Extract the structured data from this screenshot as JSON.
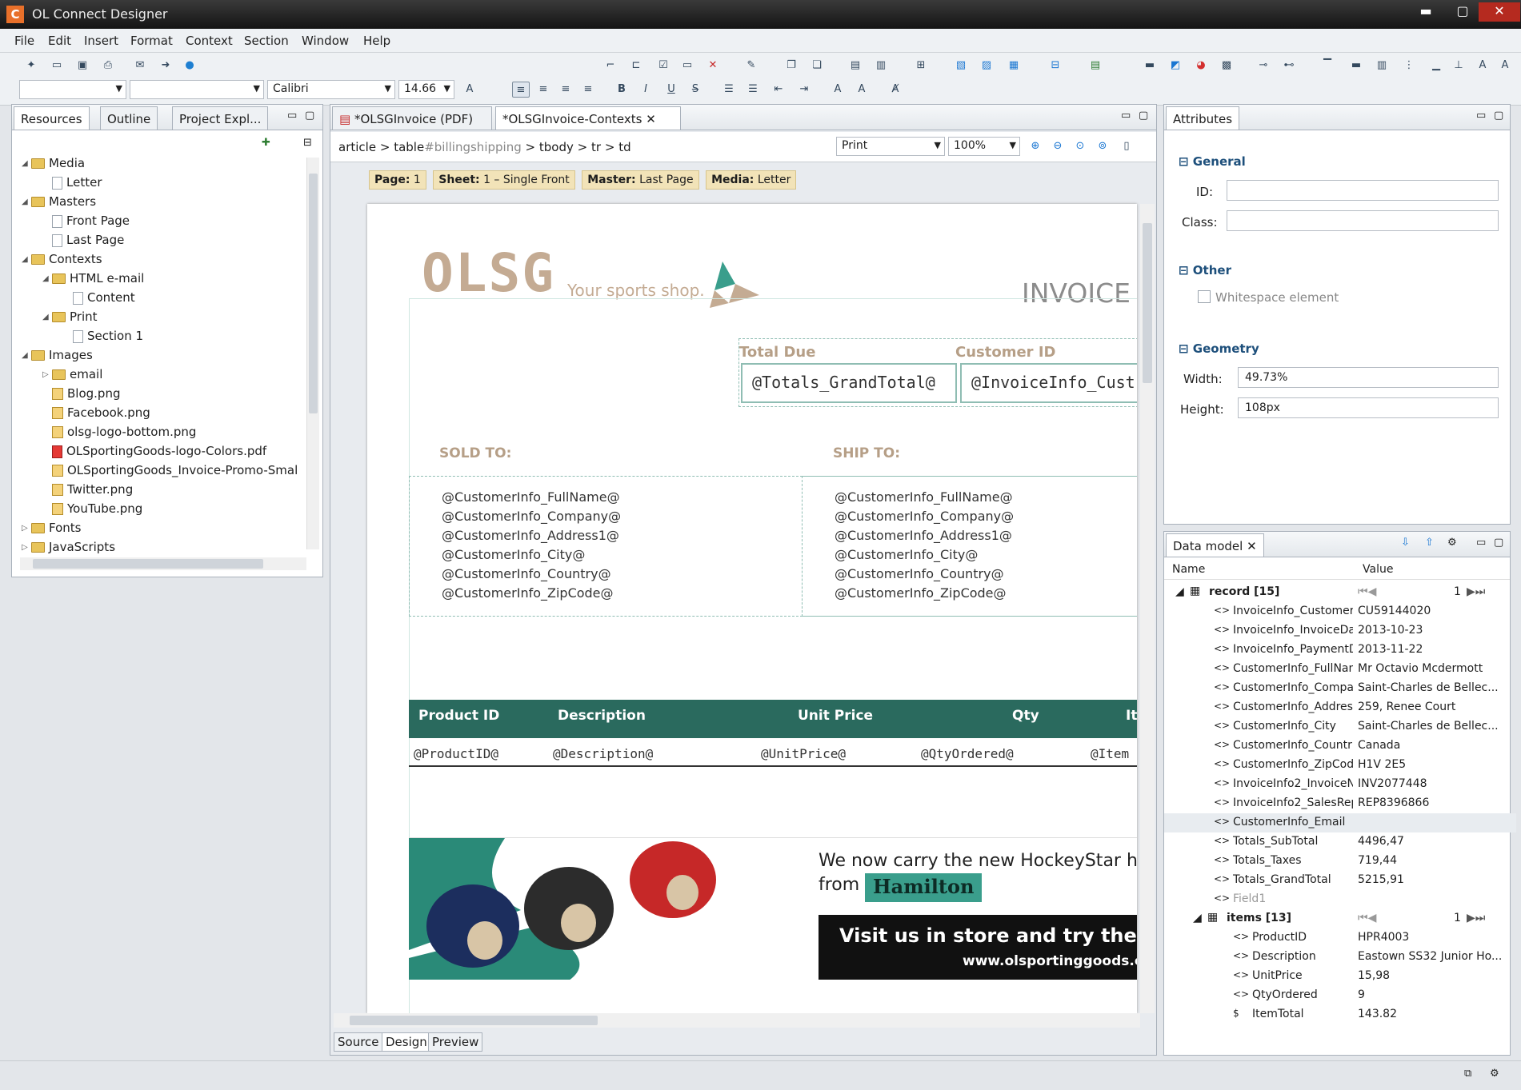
{
  "window": {
    "title": "OL Connect Designer",
    "minimize": "▬",
    "maximize": "▢",
    "close": "✕"
  },
  "menu": [
    "File",
    "Edit",
    "Insert",
    "Format",
    "Context",
    "Section",
    "Window",
    "Help"
  ],
  "toolbar": {
    "font": "Calibri",
    "size": "14.66"
  },
  "left_panel": {
    "tabs": [
      "Resources",
      "Outline",
      "Project Expl..."
    ],
    "tree": [
      {
        "label": "Media",
        "indent": 0,
        "kind": "folder",
        "open": true
      },
      {
        "label": "Letter",
        "indent": 1,
        "kind": "file"
      },
      {
        "label": "Masters",
        "indent": 0,
        "kind": "folder",
        "open": true
      },
      {
        "label": "Front Page",
        "indent": 1,
        "kind": "file"
      },
      {
        "label": "Last Page",
        "indent": 1,
        "kind": "file"
      },
      {
        "label": "Contexts",
        "indent": 0,
        "kind": "folder",
        "open": true
      },
      {
        "label": "HTML e-mail",
        "indent": 1,
        "kind": "folder",
        "open": true
      },
      {
        "label": "Content",
        "indent": 2,
        "kind": "file"
      },
      {
        "label": "Print",
        "indent": 1,
        "kind": "folder",
        "open": true
      },
      {
        "label": "Section 1",
        "indent": 2,
        "kind": "file"
      },
      {
        "label": "Images",
        "indent": 0,
        "kind": "folder",
        "open": true
      },
      {
        "label": "email",
        "indent": 1,
        "kind": "folder",
        "open": false
      },
      {
        "label": "Blog.png",
        "indent": 1,
        "kind": "img"
      },
      {
        "label": "Facebook.png",
        "indent": 1,
        "kind": "img"
      },
      {
        "label": "olsg-logo-bottom.png",
        "indent": 1,
        "kind": "img"
      },
      {
        "label": "OLSportingGoods-logo-Colors.pdf",
        "indent": 1,
        "kind": "pdf"
      },
      {
        "label": "OLSportingGoods_Invoice-Promo-Smal",
        "indent": 1,
        "kind": "img"
      },
      {
        "label": "Twitter.png",
        "indent": 1,
        "kind": "img"
      },
      {
        "label": "YouTube.png",
        "indent": 1,
        "kind": "img"
      },
      {
        "label": "Fonts",
        "indent": 0,
        "kind": "folder",
        "open": false
      },
      {
        "label": "JavaScripts",
        "indent": 0,
        "kind": "folder",
        "open": false
      }
    ]
  },
  "editor": {
    "tabs": [
      "*OLSGInvoice (PDF)",
      "*OLSGInvoice-Contexts"
    ],
    "breadcrumb": [
      "article",
      ">",
      "table",
      "#billingshipping",
      ">",
      "tbody",
      ">",
      "tr",
      ">",
      "td"
    ],
    "view_select": "Print",
    "zoom": "100%",
    "info": [
      {
        "k": "Page:",
        "v": "1"
      },
      {
        "k": "Sheet:",
        "v": "1 – Single Front"
      },
      {
        "k": "Master:",
        "v": "Last Page"
      },
      {
        "k": "Media:",
        "v": "Letter"
      }
    ],
    "bottom_tabs": [
      "Source",
      "Design",
      "Preview"
    ],
    "doc": {
      "logo": "OLSG",
      "tagline": "Your sports shop.",
      "invoice": "INVOICE",
      "total_due_label": "Total Due",
      "customer_id_label": "Customer ID",
      "total_due_value": "@Totals_GrandTotal@",
      "customer_id_value": "@InvoiceInfo_Cust",
      "sold_to": "SOLD TO:",
      "ship_to": "SHIP TO:",
      "address": [
        "@CustomerInfo_FullName@",
        "@CustomerInfo_Company@",
        "@CustomerInfo_Address1@",
        "@CustomerInfo_City@",
        "@CustomerInfo_Country@",
        "@CustomerInfo_ZipCode@"
      ],
      "table_headers": [
        "Product ID",
        "Description",
        "Unit Price",
        "Qty",
        "It"
      ],
      "table_row": [
        "@ProductID@",
        "@Description@",
        "@UnitPrice@",
        "@QtyOrdered@",
        "@Item"
      ],
      "promo_line1": "We now carry the new HockeyStar hel",
      "promo_from": "from",
      "promo_brand": "Hamilton",
      "promo_line2": "Visit us in store and try them o",
      "promo_url": "www.olsportinggoods.c"
    }
  },
  "attributes": {
    "tab": "Attributes",
    "general": "General",
    "id_label": "ID:",
    "class_label": "Class:",
    "other": "Other",
    "whitespace": "Whitespace element",
    "geometry": "Geometry",
    "width_label": "Width:",
    "width_value": "49.73%",
    "height_label": "Height:",
    "height_value": "108px"
  },
  "data_model": {
    "tab": "Data model",
    "col_name": "Name",
    "col_value": "Value",
    "record": "record [15]",
    "record_index": "1",
    "rows": [
      {
        "n": "InvoiceInfo_CustomerI",
        "v": "CU59144020"
      },
      {
        "n": "InvoiceInfo_InvoiceDa",
        "v": "2013-10-23"
      },
      {
        "n": "InvoiceInfo_PaymentD",
        "v": "2013-11-22"
      },
      {
        "n": "CustomerInfo_FullNam",
        "v": "Mr Octavio Mcdermott"
      },
      {
        "n": "CustomerInfo_Compa",
        "v": "Saint-Charles de Bellec..."
      },
      {
        "n": "CustomerInfo_Addres",
        "v": "259, Renee Court"
      },
      {
        "n": "CustomerInfo_City",
        "v": "Saint-Charles de Bellec..."
      },
      {
        "n": "CustomerInfo_Countr",
        "v": "Canada"
      },
      {
        "n": "CustomerInfo_ZipCod",
        "v": "H1V 2E5"
      },
      {
        "n": "InvoiceInfo2_InvoiceN",
        "v": "INV2077448"
      },
      {
        "n": "InvoiceInfo2_SalesRep",
        "v": "REP8396866"
      },
      {
        "n": "CustomerInfo_Email",
        "v": ""
      },
      {
        "n": "Totals_SubTotal",
        "v": "4496,47"
      },
      {
        "n": "Totals_Taxes",
        "v": "719,44"
      },
      {
        "n": "Totals_GrandTotal",
        "v": "5215,91"
      },
      {
        "n": "Field1",
        "v": ""
      }
    ],
    "items": "items [13]",
    "items_index": "1",
    "item_rows": [
      {
        "n": "ProductID",
        "v": "HPR4003"
      },
      {
        "n": "Description",
        "v": "Eastown SS32 Junior Ho..."
      },
      {
        "n": "UnitPrice",
        "v": "15,98"
      },
      {
        "n": "QtyOrdered",
        "v": "9"
      },
      {
        "n": "ItemTotal",
        "v": "143.82"
      }
    ]
  },
  "colors": {
    "teal": "#2a6a5e",
    "tan": "#c4ab93",
    "accent": "#3a9e8c"
  }
}
